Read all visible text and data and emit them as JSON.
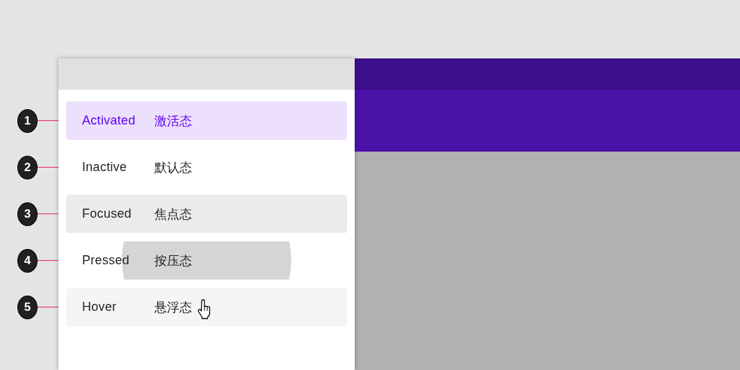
{
  "drawer": {
    "items": [
      {
        "marker": "1",
        "label": "Activated",
        "label_zh": "激活态",
        "kind": "activated"
      },
      {
        "marker": "2",
        "label": "Inactive",
        "label_zh": "默认态",
        "kind": "inactive"
      },
      {
        "marker": "3",
        "label": "Focused",
        "label_zh": "焦点态",
        "kind": "focused"
      },
      {
        "marker": "4",
        "label": "Pressed",
        "label_zh": "按压态",
        "kind": "pressed"
      },
      {
        "marker": "5",
        "label": "Hover",
        "label_zh": "悬浮态",
        "kind": "hover"
      }
    ]
  }
}
